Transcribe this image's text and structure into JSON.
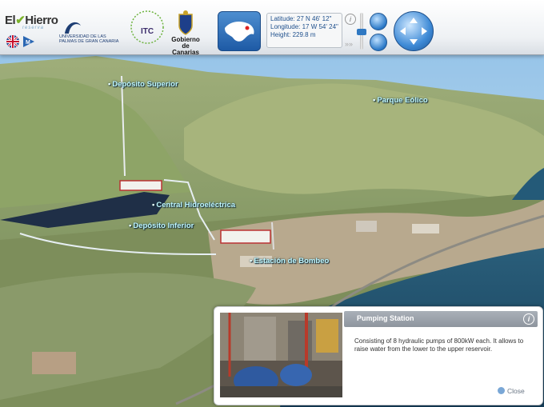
{
  "header": {
    "logo_el": "El",
    "logo_hierro": "Hierro",
    "logo_sub": "reserva",
    "lang": "M",
    "ulpgc": "UNIVERSIDAD DE LAS PALMAS DE GRAN CANARIA",
    "itc": "ITC",
    "itc_ring": "Instituto Tecnológico de Canarias",
    "gobierno": "Gobierno de Canarias"
  },
  "coords": {
    "latitude": "Latitude: 27 N 46' 12\"",
    "longitude": "Longitude: 17 W 54' 24\"",
    "height": "Height: 229.8 m"
  },
  "controls": {
    "info": "i",
    "fast_forward": "»»"
  },
  "map_labels": {
    "deposito_superior": "Depósito Superior",
    "parque_eolico": "Parque Eólico",
    "central_hidroelectrica": "Central Hidroeléctrica",
    "deposito_inferior": "Depósito Inferior",
    "estacion_bombeo": "Estación de Bombeo"
  },
  "panel": {
    "title": "Pumping Station",
    "info": "i",
    "description": "Consisting of 8 hydraulic pumps of 800kW each. It allows to raise water from the lower to the upper reservoir.",
    "close_label": "Close"
  },
  "colors": {
    "accent": "#2a78c7",
    "label_text": "#bff6ff",
    "panel_header": "#9aa1aa"
  }
}
